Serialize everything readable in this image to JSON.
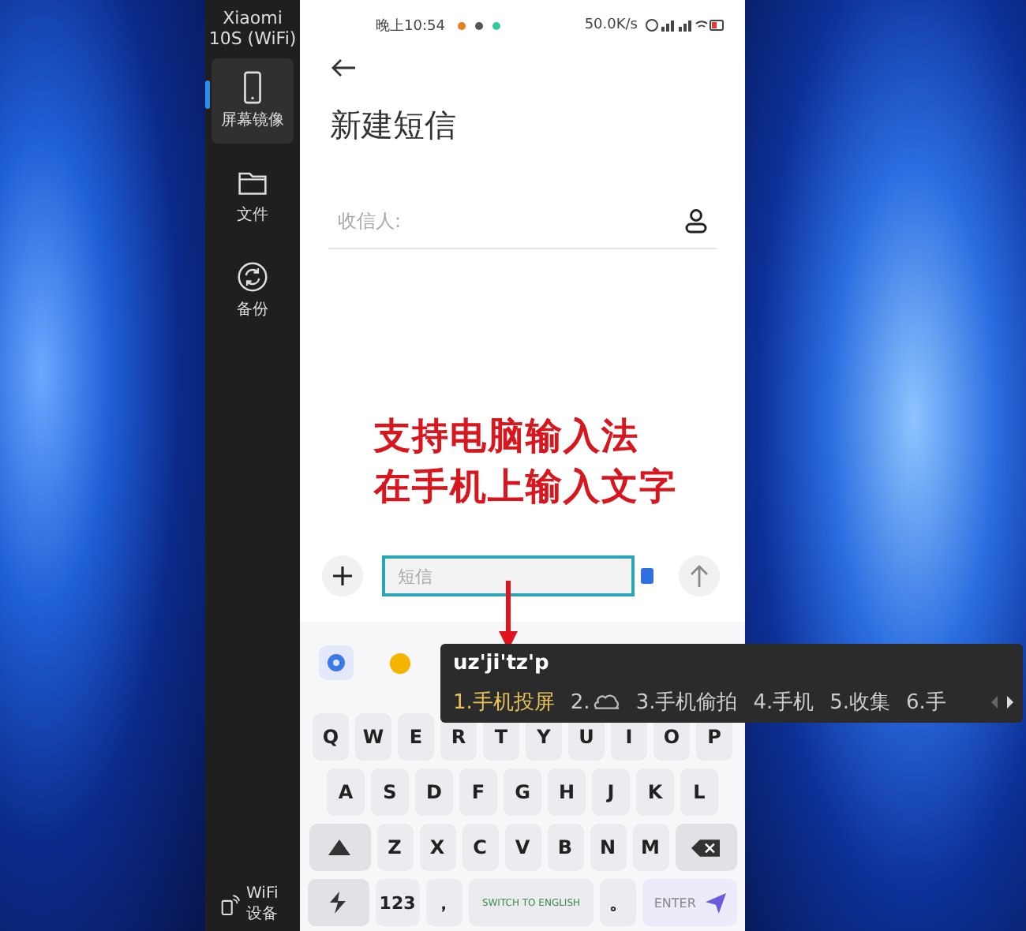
{
  "sidebar": {
    "device": "Xiaomi 10S (WiFi)",
    "items": [
      {
        "label": "屏幕镜像",
        "kind": "phone",
        "selected": true
      },
      {
        "label": "文件",
        "kind": "folder",
        "selected": false
      },
      {
        "label": "备份",
        "kind": "sync",
        "selected": false
      }
    ],
    "footer": "WiFi设备"
  },
  "status_bar": {
    "time": "晚上10:54",
    "speed": "50.0K/s"
  },
  "screen": {
    "title": "新建短信",
    "recipient_placeholder": "收信人:",
    "message_placeholder": "短信"
  },
  "annotation": {
    "lines": [
      "支持电脑输入法",
      "在手机上输入文字"
    ]
  },
  "ime": {
    "composition": "uz'ji'tz'p",
    "candidates": [
      {
        "index": "1.",
        "text": "手机投屏",
        "kind": "text",
        "selected": true
      },
      {
        "index": "2.",
        "kind": "cloud",
        "selected": false
      },
      {
        "index": "3.",
        "text": "手机偷拍",
        "kind": "text",
        "selected": false
      },
      {
        "index": "4.",
        "text": "手机",
        "kind": "text",
        "selected": false
      },
      {
        "index": "5.",
        "text": "收集",
        "kind": "text",
        "selected": false
      },
      {
        "index": "6.",
        "text": "手",
        "kind": "text",
        "selected": false
      }
    ]
  },
  "keyboard": {
    "rows": [
      [
        {
          "kind": "letter",
          "label": "Q"
        },
        {
          "kind": "letter",
          "label": "W"
        },
        {
          "kind": "letter",
          "label": "E"
        },
        {
          "kind": "letter",
          "label": "R"
        },
        {
          "kind": "letter",
          "label": "T"
        },
        {
          "kind": "letter",
          "label": "Y"
        },
        {
          "kind": "letter",
          "label": "U"
        },
        {
          "kind": "letter",
          "label": "I"
        },
        {
          "kind": "letter",
          "label": "O"
        },
        {
          "kind": "letter",
          "label": "P"
        }
      ],
      [
        {
          "kind": "letter",
          "label": "A"
        },
        {
          "kind": "letter",
          "label": "S"
        },
        {
          "kind": "letter",
          "label": "D"
        },
        {
          "kind": "letter",
          "label": "F"
        },
        {
          "kind": "letter",
          "label": "G"
        },
        {
          "kind": "letter",
          "label": "H"
        },
        {
          "kind": "letter",
          "label": "J"
        },
        {
          "kind": "letter",
          "label": "K"
        },
        {
          "kind": "letter",
          "label": "L"
        }
      ],
      [
        {
          "kind": "shift"
        },
        {
          "kind": "letter",
          "label": "Z"
        },
        {
          "kind": "letter",
          "label": "X"
        },
        {
          "kind": "letter",
          "label": "C"
        },
        {
          "kind": "letter",
          "label": "V"
        },
        {
          "kind": "letter",
          "label": "B"
        },
        {
          "kind": "letter",
          "label": "N"
        },
        {
          "kind": "letter",
          "label": "M"
        },
        {
          "kind": "backspace"
        }
      ],
      [
        {
          "kind": "switch"
        },
        {
          "kind": "num",
          "label": "123"
        },
        {
          "kind": "punct",
          "label": "，"
        },
        {
          "kind": "space",
          "label": "SWITCH TO ENGLISH"
        },
        {
          "kind": "punct",
          "label": "。"
        },
        {
          "kind": "enter",
          "label": "ENTER"
        }
      ]
    ]
  }
}
